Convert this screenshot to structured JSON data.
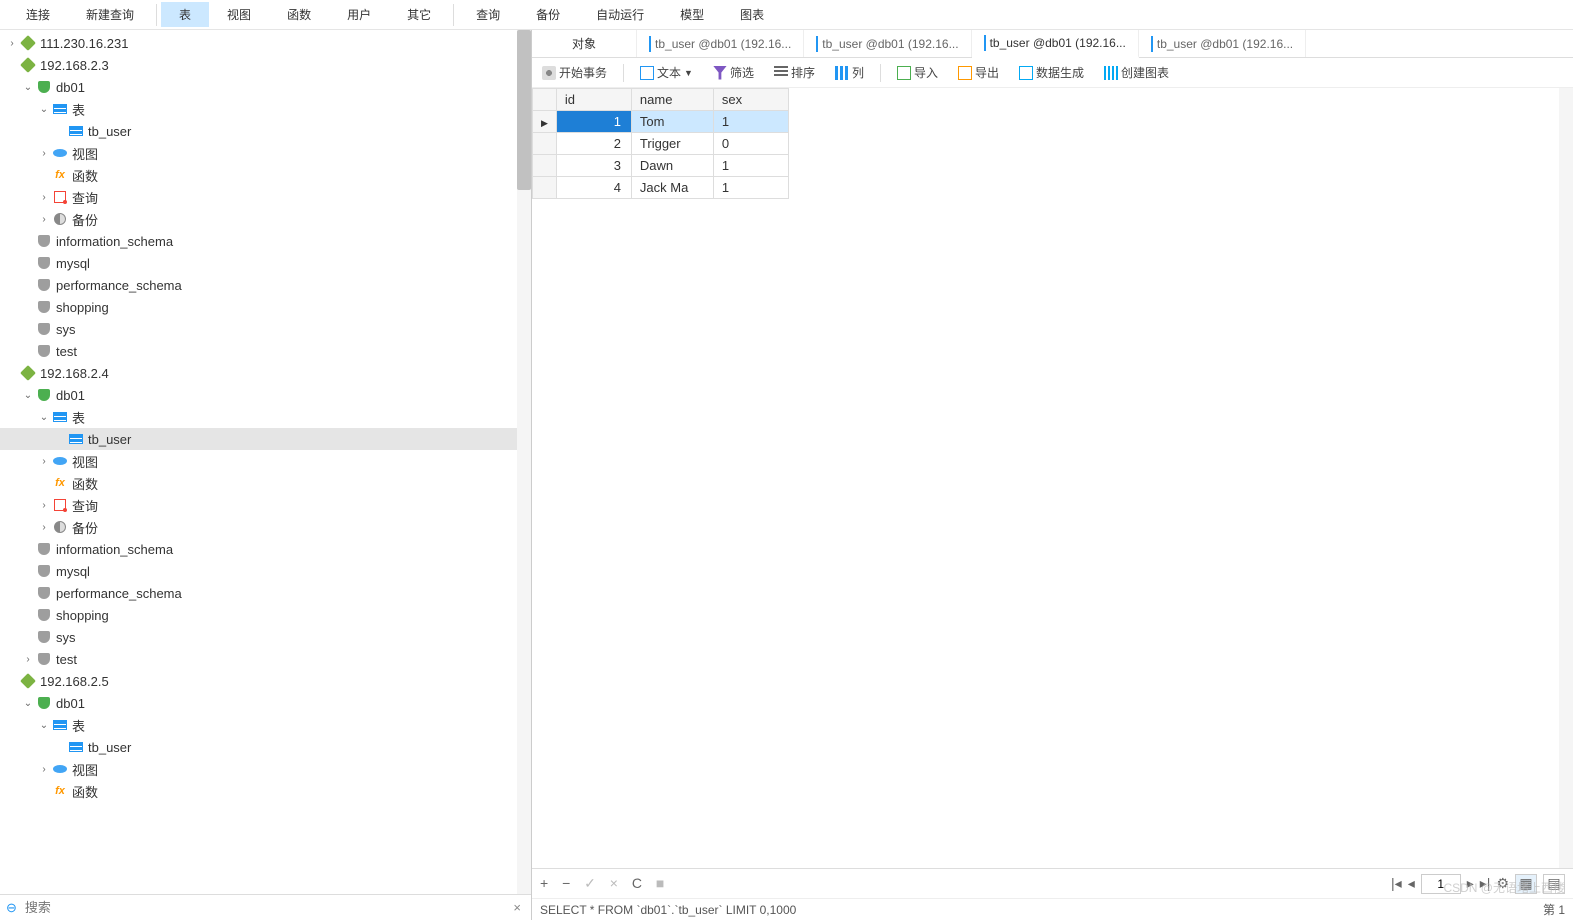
{
  "toolbar": {
    "connect": "连接",
    "new_query": "新建查询",
    "table": "表",
    "view": "视图",
    "function": "函数",
    "user": "用户",
    "other": "其它",
    "query": "查询",
    "backup": "备份",
    "auto_run": "自动运行",
    "model": "模型",
    "chart": "图表"
  },
  "tree": [
    {
      "indent": 0,
      "arrow": "›",
      "icon": "conn",
      "label": "111.230.16.231"
    },
    {
      "indent": 0,
      "arrow": "",
      "icon": "conn",
      "label": "192.168.2.3"
    },
    {
      "indent": 1,
      "arrow": "⌄",
      "icon": "db",
      "label": "db01"
    },
    {
      "indent": 2,
      "arrow": "⌄",
      "icon": "table",
      "label": "表"
    },
    {
      "indent": 3,
      "arrow": "",
      "icon": "table",
      "label": "tb_user"
    },
    {
      "indent": 2,
      "arrow": "›",
      "icon": "view",
      "label": "视图"
    },
    {
      "indent": 2,
      "arrow": "",
      "icon": "fx",
      "label": "函数"
    },
    {
      "indent": 2,
      "arrow": "›",
      "icon": "query",
      "label": "查询"
    },
    {
      "indent": 2,
      "arrow": "›",
      "icon": "backup",
      "label": "备份"
    },
    {
      "indent": 1,
      "arrow": "",
      "icon": "db-off",
      "label": "information_schema"
    },
    {
      "indent": 1,
      "arrow": "",
      "icon": "db-off",
      "label": "mysql"
    },
    {
      "indent": 1,
      "arrow": "",
      "icon": "db-off",
      "label": "performance_schema"
    },
    {
      "indent": 1,
      "arrow": "",
      "icon": "db-off",
      "label": "shopping"
    },
    {
      "indent": 1,
      "arrow": "",
      "icon": "db-off",
      "label": "sys"
    },
    {
      "indent": 1,
      "arrow": "",
      "icon": "db-off",
      "label": "test"
    },
    {
      "indent": 0,
      "arrow": "",
      "icon": "conn",
      "label": "192.168.2.4"
    },
    {
      "indent": 1,
      "arrow": "⌄",
      "icon": "db",
      "label": "db01"
    },
    {
      "indent": 2,
      "arrow": "⌄",
      "icon": "table",
      "label": "表"
    },
    {
      "indent": 3,
      "arrow": "",
      "icon": "table",
      "label": "tb_user",
      "selected": true
    },
    {
      "indent": 2,
      "arrow": "›",
      "icon": "view",
      "label": "视图"
    },
    {
      "indent": 2,
      "arrow": "",
      "icon": "fx",
      "label": "函数"
    },
    {
      "indent": 2,
      "arrow": "›",
      "icon": "query",
      "label": "查询"
    },
    {
      "indent": 2,
      "arrow": "›",
      "icon": "backup",
      "label": "备份"
    },
    {
      "indent": 1,
      "arrow": "",
      "icon": "db-off",
      "label": "information_schema"
    },
    {
      "indent": 1,
      "arrow": "",
      "icon": "db-off",
      "label": "mysql"
    },
    {
      "indent": 1,
      "arrow": "",
      "icon": "db-off",
      "label": "performance_schema"
    },
    {
      "indent": 1,
      "arrow": "",
      "icon": "db-off",
      "label": "shopping"
    },
    {
      "indent": 1,
      "arrow": "",
      "icon": "db-off",
      "label": "sys"
    },
    {
      "indent": 1,
      "arrow": "›",
      "icon": "db-off",
      "label": "test"
    },
    {
      "indent": 0,
      "arrow": "",
      "icon": "conn",
      "label": "192.168.2.5"
    },
    {
      "indent": 1,
      "arrow": "⌄",
      "icon": "db",
      "label": "db01"
    },
    {
      "indent": 2,
      "arrow": "⌄",
      "icon": "table",
      "label": "表"
    },
    {
      "indent": 3,
      "arrow": "",
      "icon": "table",
      "label": "tb_user"
    },
    {
      "indent": 2,
      "arrow": "›",
      "icon": "view",
      "label": "视图"
    },
    {
      "indent": 2,
      "arrow": "",
      "icon": "fx",
      "label": "函数"
    }
  ],
  "search_placeholder": "搜索",
  "tabs": {
    "object": "对象",
    "t1": "tb_user @db01 (192.16...",
    "t2": "tb_user @db01 (192.16...",
    "t3": "tb_user @db01 (192.16...",
    "t4": "tb_user @db01 (192.16..."
  },
  "subtoolbar": {
    "begin_tx": "开始事务",
    "text": "文本",
    "filter": "筛选",
    "sort": "排序",
    "cols": "列",
    "import": "导入",
    "export": "导出",
    "gen": "数据生成",
    "create_chart": "创建图表"
  },
  "grid": {
    "headers": [
      "id",
      "name",
      "sex"
    ],
    "rows": [
      {
        "id": "1",
        "name": "Tom",
        "sex": "1",
        "selected": true
      },
      {
        "id": "2",
        "name": "Trigger",
        "sex": "0"
      },
      {
        "id": "3",
        "name": "Dawn",
        "sex": "1"
      },
      {
        "id": "4",
        "name": "Jack Ma",
        "sex": "1"
      }
    ]
  },
  "pager": {
    "page": "1"
  },
  "sql": "SELECT * FROM `db01`.`tb_user` LIMIT 0,1000",
  "status_right": "第 1",
  "watermark": "CSDN @无语堵上西楼"
}
